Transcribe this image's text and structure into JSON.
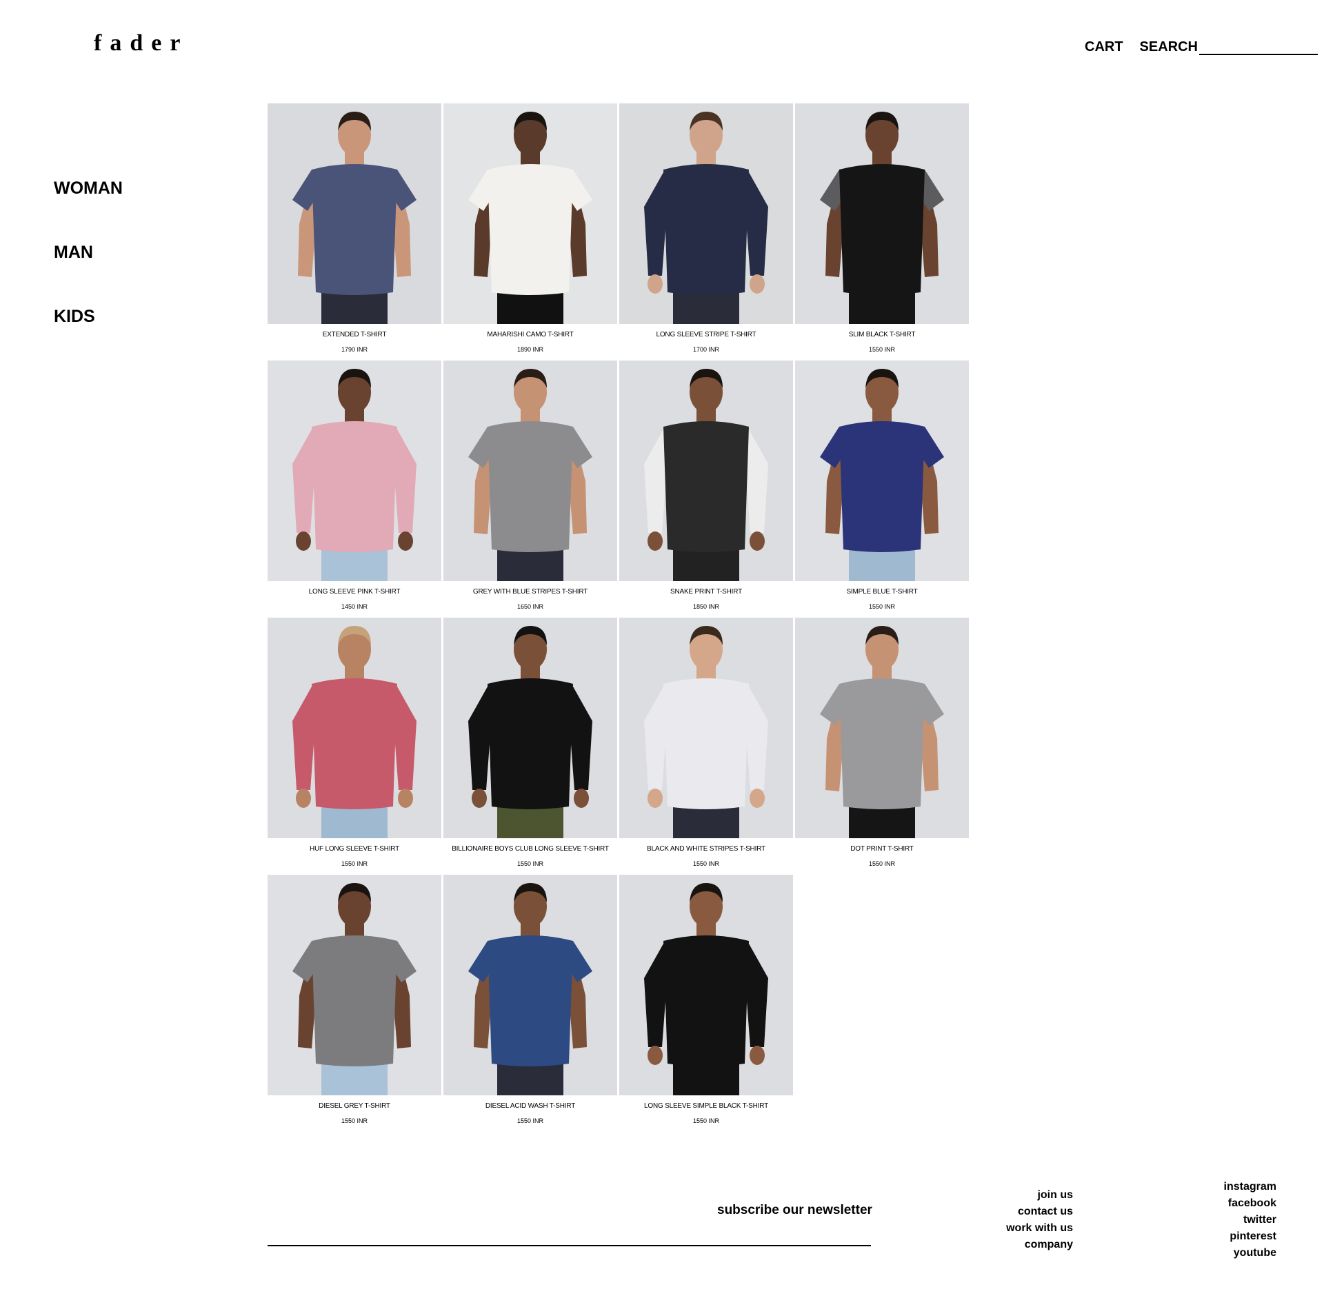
{
  "header": {
    "logo": "fader",
    "cart_label": "CART",
    "search_label": "SEARCH"
  },
  "sidebar": {
    "items": [
      {
        "label": "WOMAN"
      },
      {
        "label": "MAN"
      },
      {
        "label": "KIDS"
      }
    ]
  },
  "products": [
    {
      "name": "EXTENDED T-SHIRT",
      "price": "1790 INR",
      "bg": "#d9dadd",
      "shirt": "#4a5478",
      "sleeve": "#4a5478",
      "skin": "#c9967a",
      "hair": "#2a1d17",
      "pants": "#2a2c3a",
      "long": false
    },
    {
      "name": "MAHARISHI CAMO T-SHIRT",
      "price": "1890 INR",
      "bg": "#e3e4e6",
      "shirt": "#f2f1ee",
      "sleeve": "#f2f1ee",
      "skin": "#5a3a2a",
      "hair": "#1a1410",
      "pants": "#111111",
      "long": false
    },
    {
      "name": "LONG SLEEVE STRIPE T-SHIRT",
      "price": "1700 INR",
      "bg": "#dadbdd",
      "shirt": "#262c45",
      "sleeve": "#262c45",
      "skin": "#d0a48a",
      "hair": "#4a3322",
      "pants": "#2a2c3a",
      "long": true
    },
    {
      "name": "SLIM BLACK T-SHIRT",
      "price": "1550 INR",
      "bg": "#dcdde0",
      "shirt": "#151515",
      "sleeve": "#5c5c5e",
      "skin": "#6a4330",
      "hair": "#1a1410",
      "pants": "#151515",
      "long": false
    },
    {
      "name": "LONG SLEEVE PINK T-SHIRT",
      "price": "1450 INR",
      "bg": "#dfe0e3",
      "shirt": "#e2aab6",
      "sleeve": "#e2aab6",
      "skin": "#6a4330",
      "hair": "#1a1410",
      "pants": "#a9c2d8",
      "long": true
    },
    {
      "name": "GREY WITH BLUE STRIPES T-SHIRT",
      "price": "1650 INR",
      "bg": "#dcdde0",
      "shirt": "#8c8c8e",
      "sleeve": "#8c8c8e",
      "skin": "#c59274",
      "hair": "#2a1d17",
      "pants": "#2a2c3a",
      "long": false
    },
    {
      "name": "SNAKE PRINT T-SHIRT",
      "price": "1850 INR",
      "bg": "#dcdde0",
      "shirt": "#2a2a2a",
      "sleeve": "#ececec",
      "skin": "#7a5038",
      "hair": "#1a1410",
      "pants": "#222222",
      "long": true
    },
    {
      "name": "SIMPLE BLUE T-SHIRT",
      "price": "1550 INR",
      "bg": "#dfe0e3",
      "shirt": "#2b3478",
      "sleeve": "#2b3478",
      "skin": "#8a5a40",
      "hair": "#1a1410",
      "pants": "#9fb9d0",
      "long": false
    },
    {
      "name": "HUF LONG SLEEVE T-SHIRT",
      "price": "1550 INR",
      "bg": "#dcdde0",
      "shirt": "#c65a6a",
      "sleeve": "#c65a6a",
      "skin": "#b88363",
      "hair": "#c5a27a",
      "pants": "#9fb9d0",
      "long": true
    },
    {
      "name": "BILLIONAIRE BOYS CLUB LONG SLEEVE T-SHIRT",
      "price": "1550 INR",
      "bg": "#dcdde0",
      "shirt": "#121212",
      "sleeve": "#121212",
      "skin": "#7a5038",
      "hair": "#121212",
      "pants": "#4d5530",
      "long": true
    },
    {
      "name": "BLACK AND WHITE STRIPES T-SHIRT",
      "price": "1550 INR",
      "bg": "#dcdde0",
      "shirt": "#e9e9ee",
      "sleeve": "#e9e9ee",
      "skin": "#d4a68a",
      "hair": "#3a2a1e",
      "pants": "#2a2c3a",
      "long": true
    },
    {
      "name": "DOT PRINT T-SHIRT",
      "price": "1550 INR",
      "bg": "#dcdde0",
      "shirt": "#9a9a9c",
      "sleeve": "#9a9a9c",
      "skin": "#c59274",
      "hair": "#2a1d17",
      "pants": "#151515",
      "long": false
    },
    {
      "name": "DIESEL GREY T-SHIRT",
      "price": "1550 INR",
      "bg": "#dfe0e3",
      "shirt": "#7c7c7e",
      "sleeve": "#7c7c7e",
      "skin": "#6a4330",
      "hair": "#1a1410",
      "pants": "#a9c2d8",
      "long": false
    },
    {
      "name": "DIESEL ACID WASH T-SHIRT",
      "price": "1550 INR",
      "bg": "#dcdde0",
      "shirt": "#2d4a82",
      "sleeve": "#2d4a82",
      "skin": "#7a5038",
      "hair": "#1a1410",
      "pants": "#2a2c3a",
      "long": false
    },
    {
      "name": "LONG SLEEVE SIMPLE BLACK T-SHIRT",
      "price": "1550 INR",
      "bg": "#dcdde0",
      "shirt": "#121212",
      "sleeve": "#121212",
      "skin": "#8a5a40",
      "hair": "#1a1410",
      "pants": "#121212",
      "long": true
    }
  ],
  "newsletter": {
    "label": "subscribe our newsletter"
  },
  "footer": {
    "links": [
      {
        "label": "join us"
      },
      {
        "label": "contact us"
      },
      {
        "label": "work with us"
      },
      {
        "label": "company"
      }
    ],
    "social": [
      {
        "label": "instagram"
      },
      {
        "label": "facebook"
      },
      {
        "label": "twitter"
      },
      {
        "label": "pinterest"
      },
      {
        "label": "youtube"
      }
    ]
  }
}
